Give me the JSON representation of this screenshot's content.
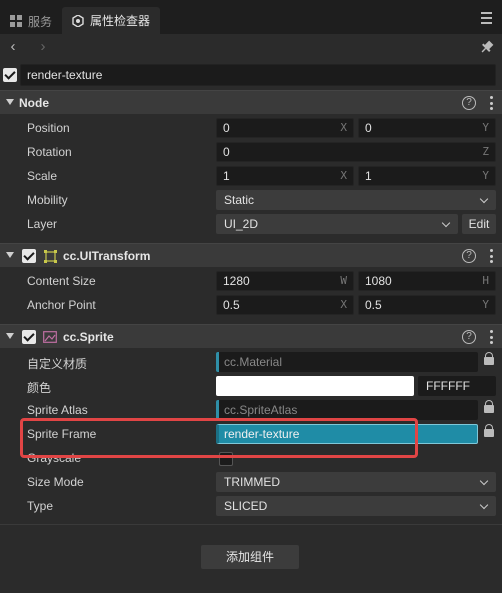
{
  "tabs": [
    {
      "label": "服务",
      "icon": "grid-icon"
    },
    {
      "label": "属性检查器",
      "icon": "inspector-icon"
    }
  ],
  "node_name": "render-texture",
  "sections": {
    "node": {
      "title": "Node"
    },
    "uitransform": {
      "title": "cc.UITransform"
    },
    "sprite": {
      "title": "cc.Sprite"
    }
  },
  "node_props": {
    "position": {
      "label": "Position",
      "x": "0",
      "y": "0",
      "x_axis": "X",
      "y_axis": "Y"
    },
    "rotation": {
      "label": "Rotation",
      "z": "0",
      "z_axis": "Z"
    },
    "scale": {
      "label": "Scale",
      "x": "1",
      "y": "1",
      "x_axis": "X",
      "y_axis": "Y"
    },
    "mobility": {
      "label": "Mobility",
      "value": "Static"
    },
    "layer": {
      "label": "Layer",
      "value": "UI_2D",
      "edit_label": "Edit"
    }
  },
  "uitransform_props": {
    "content_size": {
      "label": "Content Size",
      "w": "1280",
      "h": "1080",
      "w_axis": "W",
      "h_axis": "H"
    },
    "anchor_point": {
      "label": "Anchor Point",
      "x": "0.5",
      "y": "0.5",
      "x_axis": "X",
      "y_axis": "Y"
    }
  },
  "sprite_props": {
    "custom_material": {
      "label": "自定义材质",
      "value": "cc.Material"
    },
    "color": {
      "label": "颜色",
      "hex": "FFFFFF",
      "swatch": "#ffffff"
    },
    "sprite_atlas": {
      "label": "Sprite Atlas",
      "value": "cc.SpriteAtlas"
    },
    "sprite_frame": {
      "label": "Sprite Frame",
      "value": "render-texture"
    },
    "grayscale": {
      "label": "Grayscale",
      "checked": false
    },
    "size_mode": {
      "label": "Size Mode",
      "value": "TRIMMED"
    },
    "type": {
      "label": "Type",
      "value": "SLICED"
    }
  },
  "add_component_label": "添加组件",
  "colors": {
    "accent": "#1f8ca6",
    "highlight": "#e14545",
    "background": "#2b2b2b"
  }
}
